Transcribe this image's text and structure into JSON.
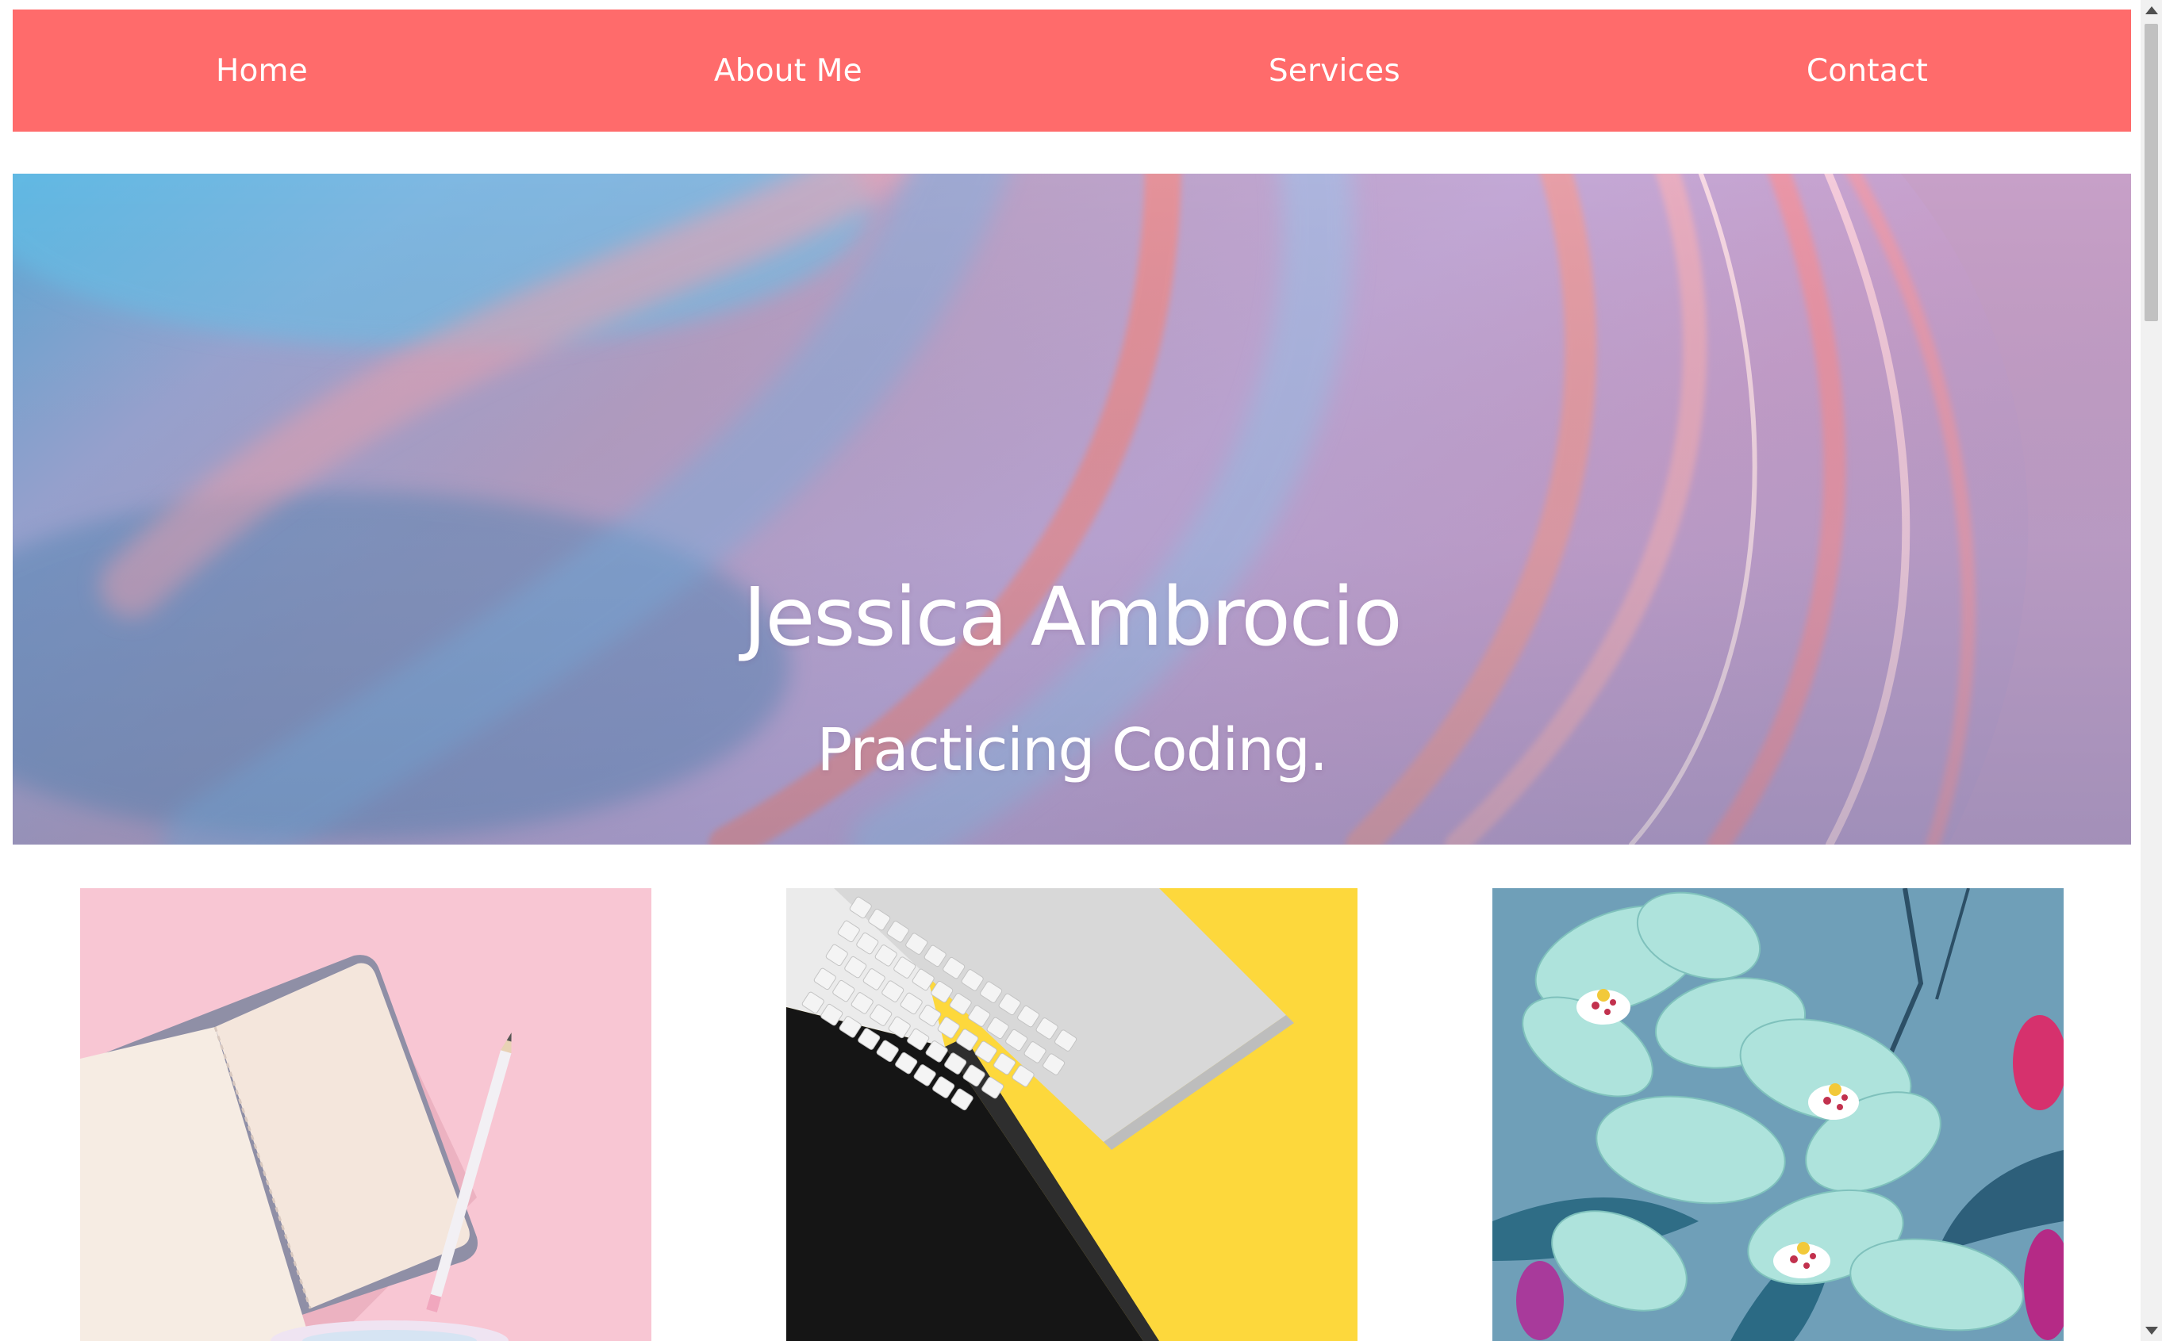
{
  "colors": {
    "nav_background": "#ff6b6b",
    "text_on_color": "#ffffff",
    "page_background": "#ffffff"
  },
  "nav": {
    "items": [
      {
        "label": "Home"
      },
      {
        "label": "About Me"
      },
      {
        "label": "Services"
      },
      {
        "label": "Contact"
      }
    ]
  },
  "hero": {
    "title": "Jessica Ambrocio",
    "subtitle": "Practicing Coding."
  },
  "gallery": {
    "images": [
      {
        "subject": "notebook-and-pencil-on-pink"
      },
      {
        "subject": "keyboard-and-tablet-on-yellow"
      },
      {
        "subject": "teal-orchids"
      }
    ]
  }
}
